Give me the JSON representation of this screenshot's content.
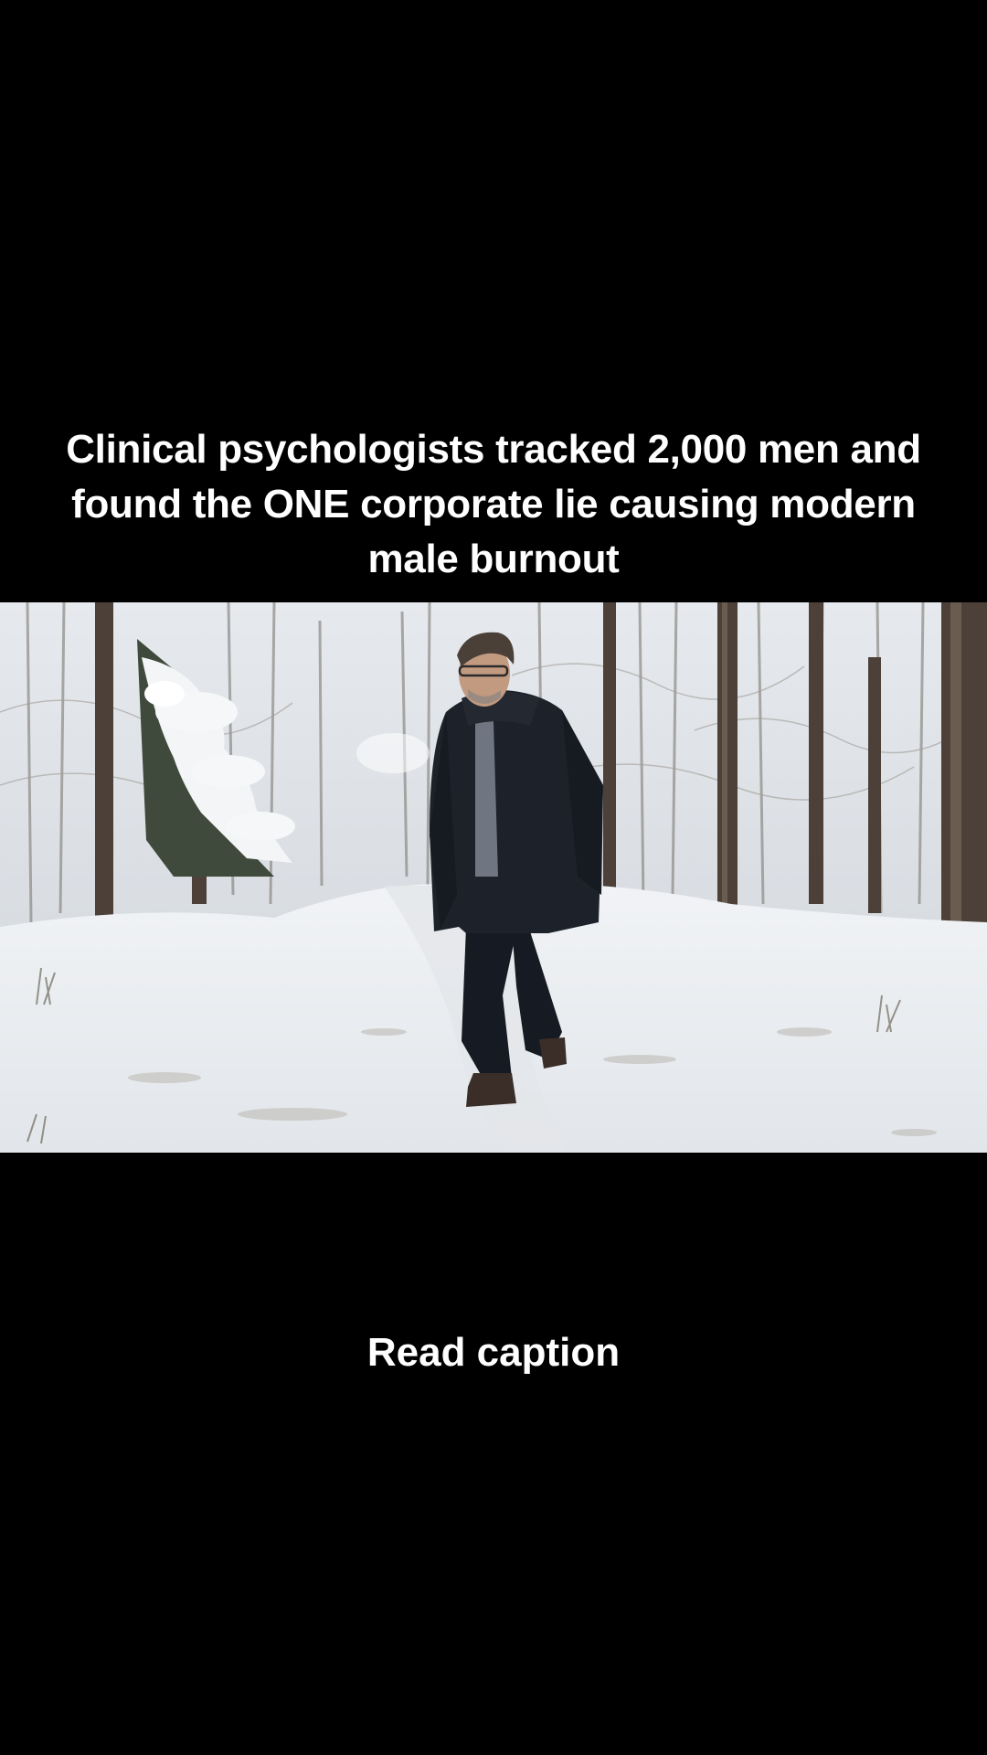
{
  "overlay": {
    "headline": "Clinical psychologists tracked 2,000 men and found the ONE corporate lie causing modern male burnout",
    "bottom_caption": "Read caption"
  },
  "colors": {
    "background": "#000000",
    "text": "#ffffff",
    "snow": "#eef1f4",
    "sky": "#dfe3e8",
    "tree_trunk": "#4a3d33",
    "jacket": "#1c2026"
  }
}
